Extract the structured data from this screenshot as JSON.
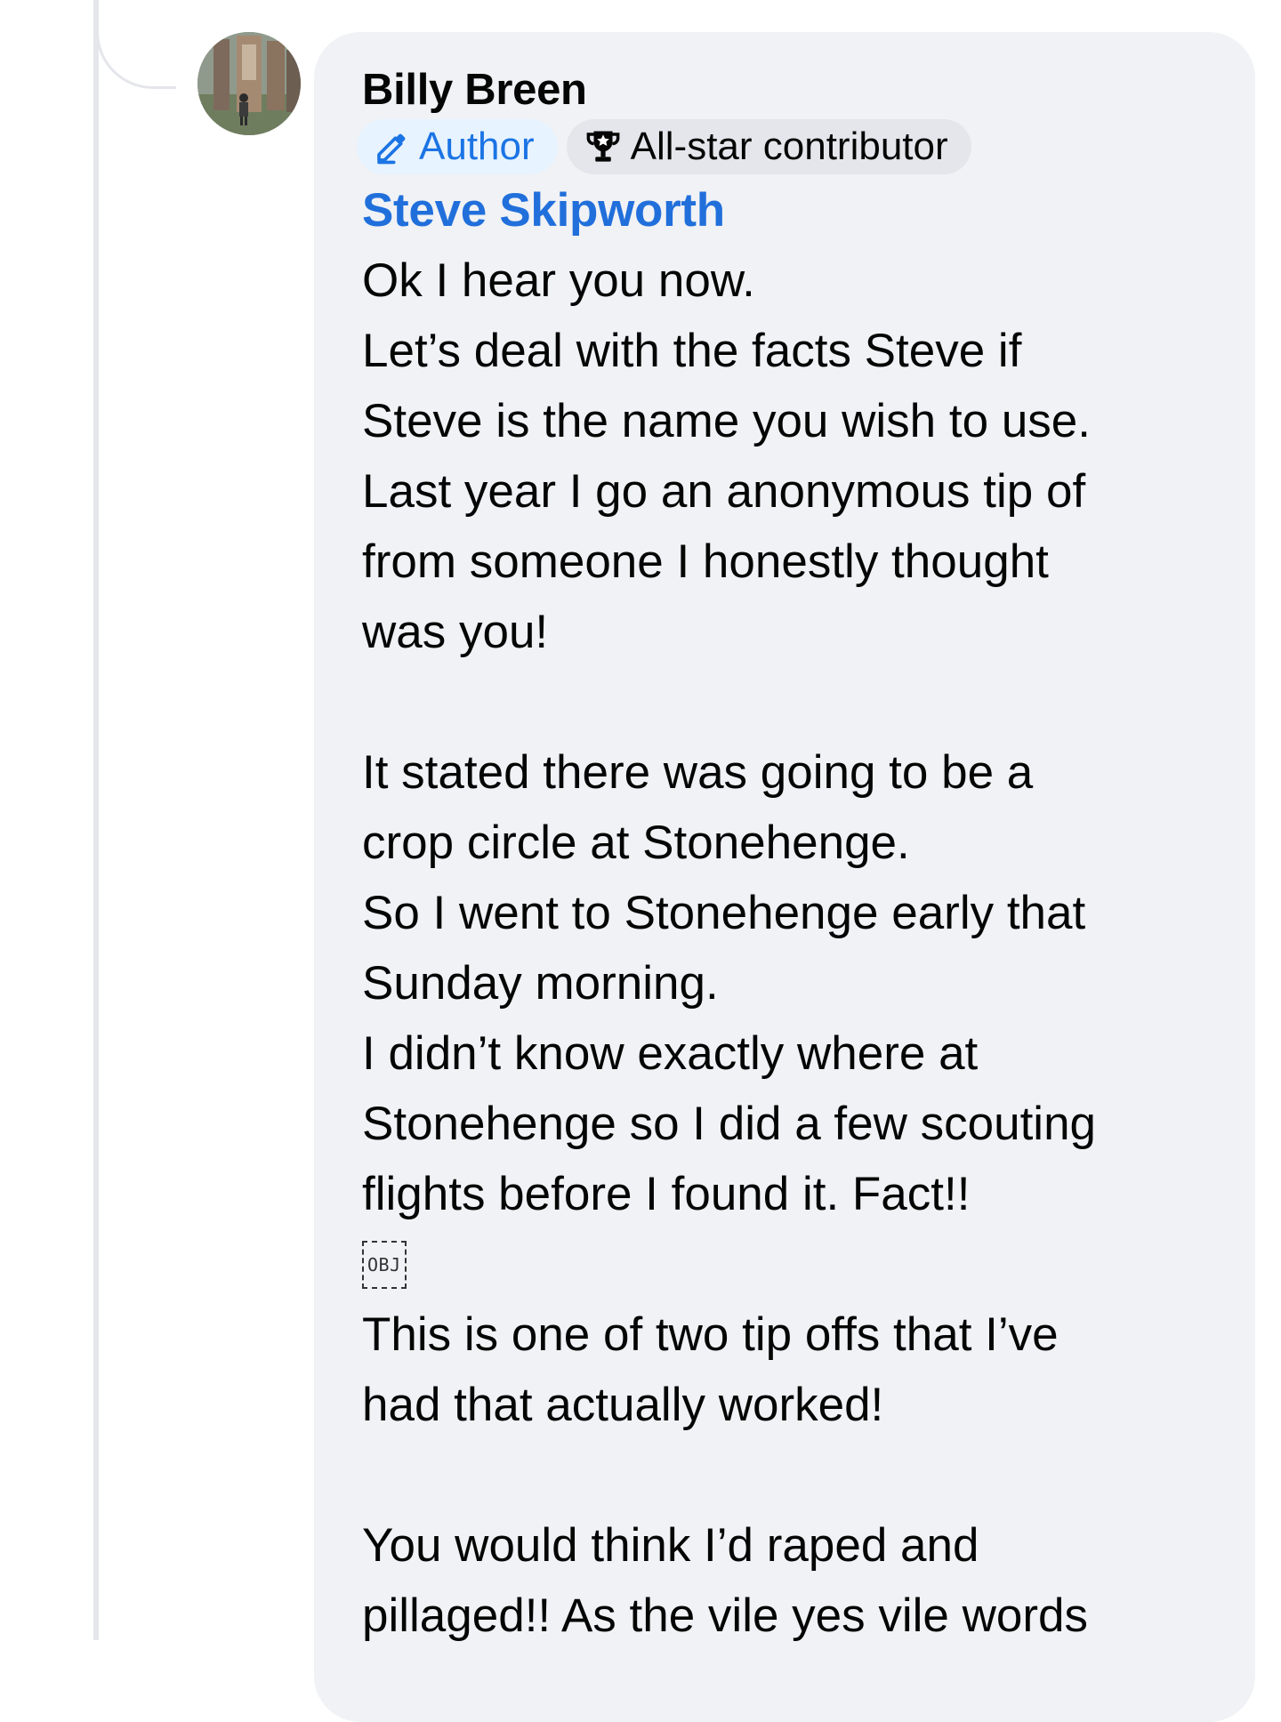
{
  "comment": {
    "author_name": "Billy Breen",
    "avatar_icon": "profile-photo-avatar",
    "badges": [
      {
        "label": "Author",
        "icon": "pencil-icon",
        "color": "#1b74e4",
        "background": "#e7f3ff"
      },
      {
        "label": "All-star contributor",
        "icon": "trophy-icon",
        "color": "#050505",
        "background": "#e4e6eb"
      }
    ],
    "mention": "Steve Skipworth",
    "mention_color": "#216fdb",
    "paragraph_1": [
      "Ok I hear you now.",
      "Let’s deal with the facts Steve if",
      "Steve is the name you wish to use.",
      "Last year I go an anonymous tip of",
      "from someone I honestly thought",
      "was you!"
    ],
    "paragraph_2": [
      "It stated there was going to be a",
      "crop circle at Stonehenge.",
      "So I went to Stonehenge early that",
      "Sunday morning.",
      "I didn’t know exactly where at",
      "Stonehenge so I did a few scouting",
      "flights before I found it. Fact!!"
    ],
    "object_placeholder": "OBJ",
    "paragraph_3": [
      "This is one of two tip offs that I’ve",
      "had that actually worked!"
    ],
    "paragraph_4": [
      "You would think I’d raped and",
      "pillaged!! As the vile yes vile words"
    ],
    "bubble_color": "#f0f2f5"
  }
}
